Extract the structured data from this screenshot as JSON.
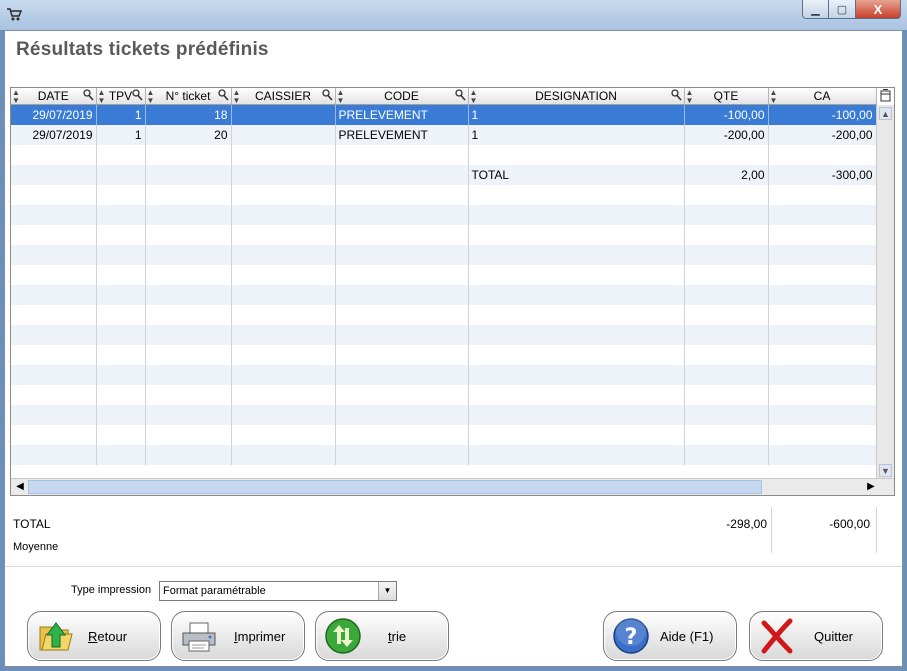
{
  "window": {
    "title": "",
    "close_glyph": "X"
  },
  "page_title": "Résultats tickets prédéfinis",
  "table": {
    "columns": [
      "DATE",
      "TPV",
      "N° ticket",
      "CAISSIER",
      "CODE",
      "DESIGNATION",
      "QTE",
      "CA"
    ],
    "rows": [
      {
        "date": "29/07/2019",
        "tpv": "1",
        "ticket": "18",
        "caissier": "",
        "code": "PRELEVEMENT",
        "designation": "1",
        "qte": "-100,00",
        "ca": "-100,00",
        "selected": true
      },
      {
        "date": "29/07/2019",
        "tpv": "1",
        "ticket": "20",
        "caissier": "",
        "code": "PRELEVEMENT",
        "designation": "1",
        "qte": "-200,00",
        "ca": "-200,00"
      },
      {
        "date": "",
        "tpv": "",
        "ticket": "",
        "caissier": "",
        "code": "",
        "designation": "",
        "qte": "",
        "ca": ""
      },
      {
        "date": "",
        "tpv": "",
        "ticket": "",
        "caissier": "",
        "code": "",
        "designation": "TOTAL",
        "qte": "2,00",
        "ca": "-300,00"
      }
    ]
  },
  "footer": {
    "total_label": "TOTAL",
    "moyenne_label": "Moyenne",
    "total_qte": "-298,00",
    "total_ca": "-600,00"
  },
  "print": {
    "label": "Type impression",
    "selected": "Format paramétrable"
  },
  "buttons": {
    "retour": {
      "first": "R",
      "rest": "etour"
    },
    "imprimer": {
      "first": "I",
      "rest": "mprimer"
    },
    "trie": {
      "first": "t",
      "rest": "rie"
    },
    "aide": "Aide (F1)",
    "quitter": "Quitter"
  },
  "icons": {
    "app": "shopping-cart-icon",
    "retour": "folder-up-arrow-icon",
    "imprimer": "printer-icon",
    "trie": "green-sort-arrows-icon",
    "aide": "help-question-icon",
    "quitter": "red-x-icon"
  }
}
